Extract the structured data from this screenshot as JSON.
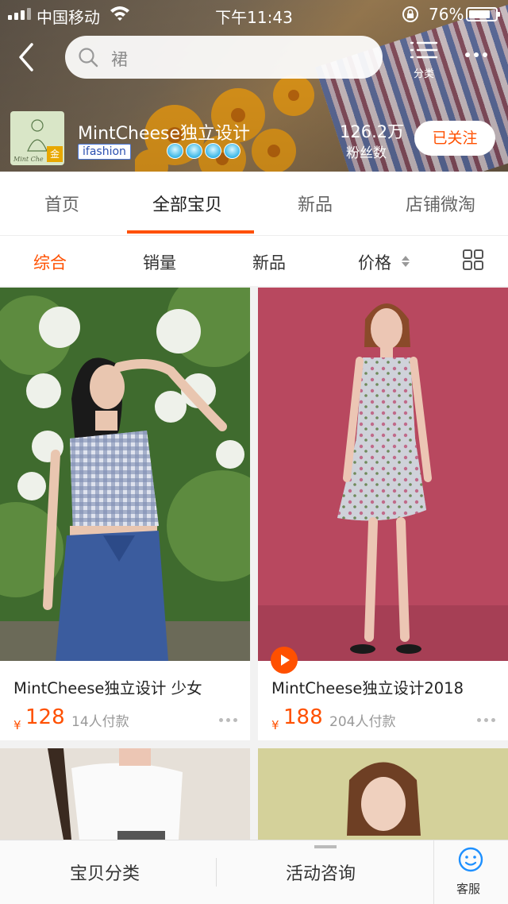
{
  "status_bar": {
    "carrier": "中国移动",
    "time": "下午11:43",
    "battery": "76%",
    "battery_level": 0.76
  },
  "search": {
    "placeholder": "裙"
  },
  "header": {
    "category_label": "分类"
  },
  "shop": {
    "name": "MintCheese独立设计",
    "badge": "ifashion",
    "logo_text": "Mint Che",
    "logo_seal": "金",
    "crown_count": 4,
    "fans_count": "126.2万",
    "fans_label": "粉丝数",
    "follow_label": "已关注"
  },
  "tabs": [
    {
      "label": "首页",
      "active": false
    },
    {
      "label": "全部宝贝",
      "active": true
    },
    {
      "label": "新品",
      "active": false
    },
    {
      "label": "店铺微淘",
      "active": false
    }
  ],
  "sorts": [
    {
      "label": "综合",
      "active": true
    },
    {
      "label": "销量",
      "active": false
    },
    {
      "label": "新品",
      "active": false
    },
    {
      "label": "价格",
      "active": false
    }
  ],
  "products": [
    {
      "title": "MintCheese独立设计 少女",
      "currency": "¥",
      "price": "128",
      "sold": "14人付款"
    },
    {
      "title": "MintCheese独立设计2018",
      "currency": "¥",
      "price": "188",
      "sold": "204人付款"
    }
  ],
  "bottom_bar": {
    "category": "宝贝分类",
    "activity": "活动咨询",
    "service": "客服"
  },
  "colors": {
    "accent": "#ff5000",
    "price": "#ff5000"
  }
}
